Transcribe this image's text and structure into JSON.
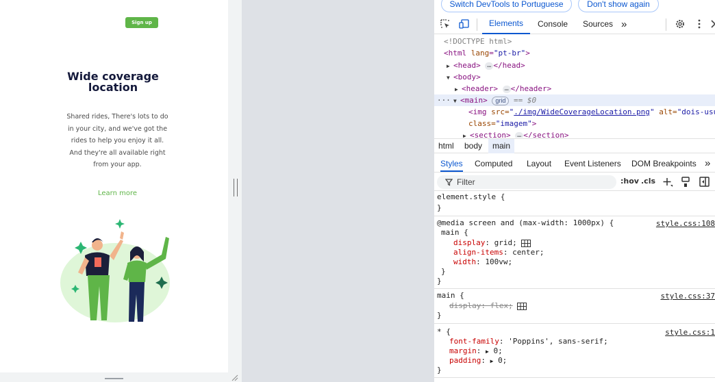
{
  "preview": {
    "signup_label": "Sign up",
    "heading": "Wide coverage location",
    "description": "Shared rides, There's lots to do in your city, and we've got the rides to help you enjoy it all. And they're all available right from your app.",
    "learn_more": "Learn more",
    "accent_color": "#5fb548",
    "heading_color": "#14193b"
  },
  "devtools": {
    "infobar": {
      "switch_lang_button": "Switch DevTools to Portuguese",
      "dont_show_button": "Don't show again"
    },
    "tabs": [
      "Elements",
      "Console",
      "Sources"
    ],
    "dom": {
      "doctype": "<!DOCTYPE html>",
      "html_open": "<html",
      "html_attr_name": "lang",
      "html_attr_value": "\"pt-br\"",
      "head_open": "<head>",
      "head_close": "</head>",
      "body_open": "<body>",
      "header_open": "<header>",
      "header_close": "</header>",
      "main_open": "<main>",
      "grid_badge": "grid",
      "selected_ref": "== $0",
      "img_tag": "<img",
      "img_src_name": "src=",
      "img_src_value": "./img/WideCoverageLocation.png",
      "img_alt_name": "alt=",
      "img_alt_value": "\"dois-usuários-acenando\"",
      "img_class_name": "class=",
      "img_class_value": "\"imagem\"",
      "section_open": "<section>",
      "section_close": "</section>",
      "ellipsis": "…"
    },
    "breadcrumbs": [
      "html",
      "body",
      "main"
    ],
    "style_tabs": [
      "Styles",
      "Computed",
      "Layout",
      "Event Listeners",
      "DOM Breakpoints"
    ],
    "filter_placeholder": "Filter",
    "hov_label": ":hov",
    "cls_label": ".cls",
    "rules": {
      "element_style": "element.style {",
      "media_query": "@media screen and (max-width: 1000px) {",
      "media_source": "style.css:108",
      "main_selector": "main {",
      "display_prop": "display",
      "display_val": "grid;",
      "align_prop": "align-items",
      "align_val": "center;",
      "width_prop": "width",
      "width_val": "100vw;",
      "main2_source": "style.css:37",
      "main2_display": "display: flex;",
      "star_selector": "* {",
      "star_source": "style.css:1",
      "font_prop": "font-family",
      "font_val": "'Poppins', sans-serif;",
      "margin_prop": "margin",
      "margin_val": "0;",
      "padding_prop": "padding",
      "padding_val": "0;",
      "close_brace": "}"
    }
  }
}
